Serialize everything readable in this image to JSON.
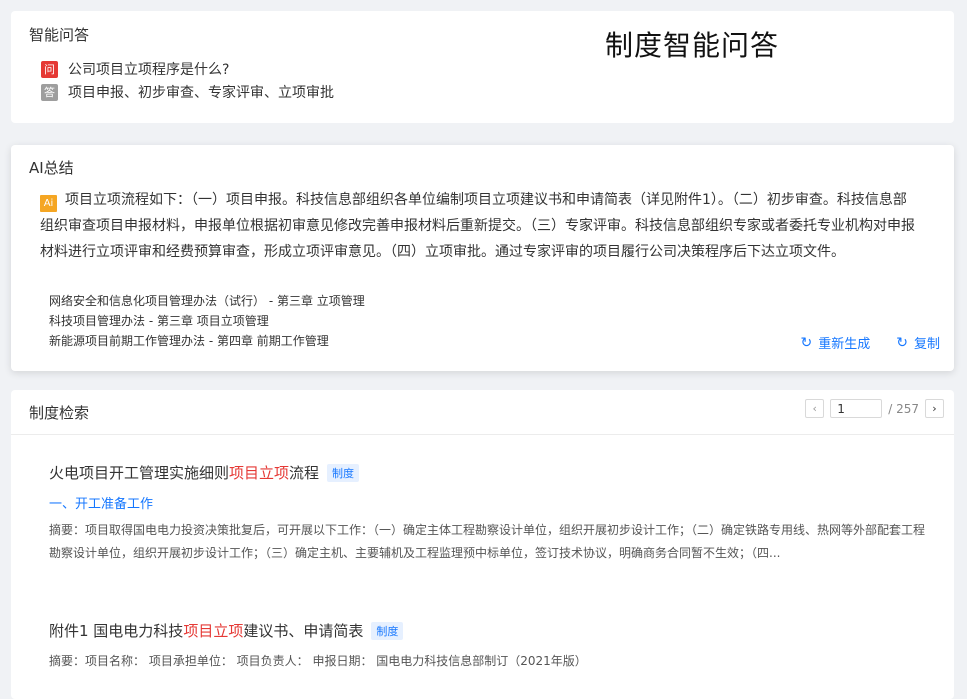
{
  "qa": {
    "title": "智能问答",
    "page_heading": "制度智能问答",
    "question_badge": "问",
    "question": "公司项目立项程序是什么?",
    "answer_badge": "答",
    "answer": "项目申报、初步审查、专家评审、立项审批"
  },
  "summary": {
    "title": "AI总结",
    "ai_badge": "Ai",
    "text": "项目立项流程如下：（一）项目申报。科技信息部组织各单位编制项目立项建议书和申请简表（详见附件1）。（二）初步审查。科技信息部组织审查项目申报材料，申报单位根据初审意见修改完善申报材料后重新提交。（三）专家评审。科技信息部组织专家或者委托专业机构对申报材料进行立项评审和经费预算审查，形成立项评审意见。（四）立项审批。通过专家评审的项目履行公司决策程序后下达立项文件。",
    "references": [
      "网络安全和信息化项目管理办法（试行） - 第三章 立项管理",
      "科技项目管理办法 - 第三章 项目立项管理",
      "新能源项目前期工作管理办法 - 第四章 前期工作管理"
    ],
    "regenerate_label": "重新生成",
    "copy_label": "复制"
  },
  "search": {
    "title": "制度检索",
    "pagination": {
      "current_page": "1",
      "total_label": "/ 257",
      "prev_icon": "chevron-left-icon",
      "next_icon": "chevron-right-icon"
    },
    "results": [
      {
        "title_before": "火电项目开工管理实施细则",
        "title_highlight": "项目立项",
        "title_after": "流程",
        "tag": "制度",
        "subheading": "一、开工准备工作",
        "abstract": "摘要：项目取得国电电力投资决策批复后，可开展以下工作：（一）确定主体工程勘察设计单位，组织开展初步设计工作；（二）确定铁路专用线、热网等外部配套工程勘察设计单位，组织开展初步设计工作；（三）确定主机、主要辅机及工程监理预中标单位，签订技术协议，明确商务合同暂不生效；（四..."
      },
      {
        "title_before": "附件1 国电电力科技",
        "title_highlight": "项目立项",
        "title_after": "建议书、申请简表",
        "tag": "制度",
        "subheading": "",
        "abstract": "摘要：项目名称： 项目承担单位： 项目负责人： 申报日期： 国电电力科技信息部制订（2021年版）"
      }
    ]
  },
  "colors": {
    "accent": "#1677ff",
    "highlight": "#e53935",
    "question_badge": "#e53935",
    "answer_badge": "#9e9e9e",
    "ai_badge": "#f5a623"
  }
}
